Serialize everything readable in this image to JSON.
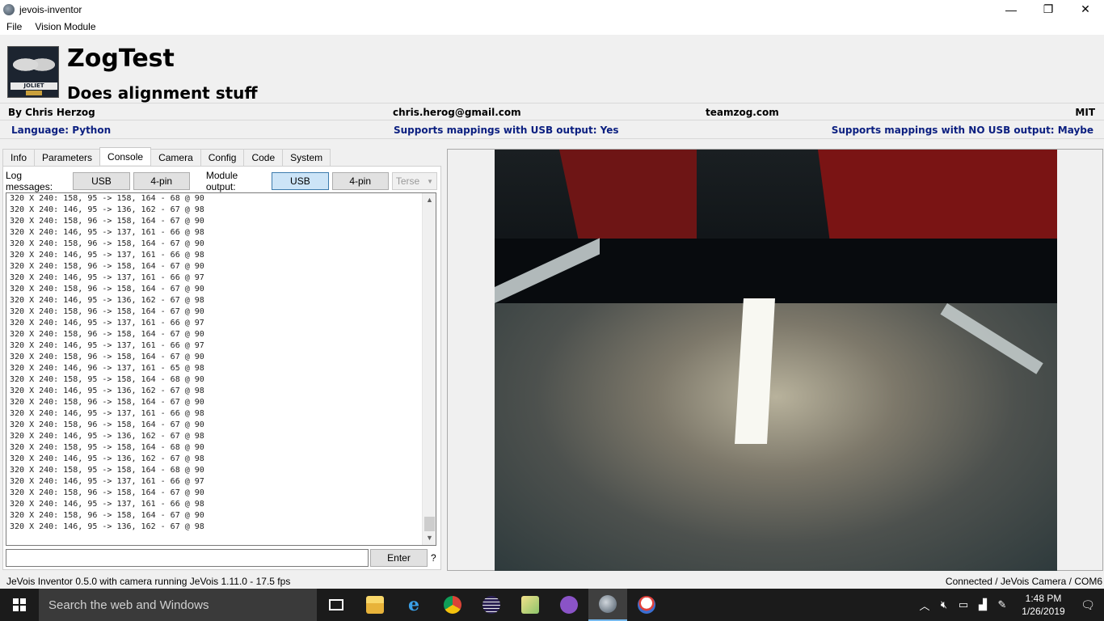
{
  "window": {
    "title": "jevois-inventor"
  },
  "window_controls": {
    "minimize": "—",
    "restore": "❐",
    "close": "✕"
  },
  "menu": {
    "file": "File",
    "vision_module": "Vision Module"
  },
  "module": {
    "logo_text": "JOLIET CYBORGS",
    "name": "ZogTest",
    "description": "Does alignment stuff",
    "author": "By Chris Herzog",
    "email": "chris.herog@gmail.com",
    "website": "teamzog.com",
    "license": "MIT",
    "language": "Language: Python",
    "usb_mappings": "Supports mappings with USB output: Yes",
    "no_usb_mappings": "Supports mappings with NO USB output: Maybe"
  },
  "tabs": [
    "Info",
    "Parameters",
    "Console",
    "Camera",
    "Config",
    "Code",
    "System"
  ],
  "console_controls": {
    "log_label": "Log messages:",
    "log_usb": "USB",
    "log_4pin": "4-pin",
    "module_output_label": "Module output:",
    "out_usb": "USB",
    "out_4pin": "4-pin",
    "verbosity": "Terse"
  },
  "console_lines": [
    "320 X 240: 158, 95 -> 158, 164 - 68 @ 90",
    "320 X 240: 146, 95 -> 136, 162 - 67 @ 98",
    "320 X 240: 158, 96 -> 158, 164 - 67 @ 90",
    "320 X 240: 146, 95 -> 137, 161 - 66 @ 98",
    "320 X 240: 158, 96 -> 158, 164 - 67 @ 90",
    "320 X 240: 146, 95 -> 137, 161 - 66 @ 98",
    "320 X 240: 158, 96 -> 158, 164 - 67 @ 90",
    "320 X 240: 146, 95 -> 137, 161 - 66 @ 97",
    "320 X 240: 158, 96 -> 158, 164 - 67 @ 90",
    "320 X 240: 146, 95 -> 136, 162 - 67 @ 98",
    "320 X 240: 158, 96 -> 158, 164 - 67 @ 90",
    "320 X 240: 146, 95 -> 137, 161 - 66 @ 97",
    "320 X 240: 158, 96 -> 158, 164 - 67 @ 90",
    "320 X 240: 146, 95 -> 137, 161 - 66 @ 97",
    "320 X 240: 158, 96 -> 158, 164 - 67 @ 90",
    "320 X 240: 146, 96 -> 137, 161 - 65 @ 98",
    "320 X 240: 158, 95 -> 158, 164 - 68 @ 90",
    "320 X 240: 146, 95 -> 136, 162 - 67 @ 98",
    "320 X 240: 158, 96 -> 158, 164 - 67 @ 90",
    "320 X 240: 146, 95 -> 137, 161 - 66 @ 98",
    "320 X 240: 158, 96 -> 158, 164 - 67 @ 90",
    "320 X 240: 146, 95 -> 136, 162 - 67 @ 98",
    "320 X 240: 158, 95 -> 158, 164 - 68 @ 90",
    "320 X 240: 146, 95 -> 136, 162 - 67 @ 98",
    "320 X 240: 158, 95 -> 158, 164 - 68 @ 90",
    "320 X 240: 146, 95 -> 137, 161 - 66 @ 97",
    "320 X 240: 158, 96 -> 158, 164 - 67 @ 90",
    "320 X 240: 146, 95 -> 137, 161 - 66 @ 98",
    "320 X 240: 158, 96 -> 158, 164 - 67 @ 90",
    "320 X 240: 146, 95 -> 136, 162 - 67 @ 98"
  ],
  "command": {
    "value": "",
    "enter_label": "Enter",
    "help": "?"
  },
  "status": {
    "left": "JeVois Inventor 0.5.0 with camera running JeVois 1.11.0 - 17.5 fps",
    "right": "Connected / JeVois Camera / COM6"
  },
  "taskbar": {
    "search_placeholder": "Search the web and Windows",
    "time": "1:48 PM",
    "date": "1/26/2019",
    "icons": [
      "task-view-icon",
      "file-explorer-icon",
      "edge-icon",
      "chrome-icon",
      "eclipse-icon",
      "folder-app-icon",
      "github-desktop-icon",
      "jevois-inventor-icon",
      "paint-icon"
    ]
  },
  "colors": {
    "accent_blue": "#0b1f80",
    "selected_button": "#cce4f7",
    "taskbar": "#1b1b1b"
  }
}
